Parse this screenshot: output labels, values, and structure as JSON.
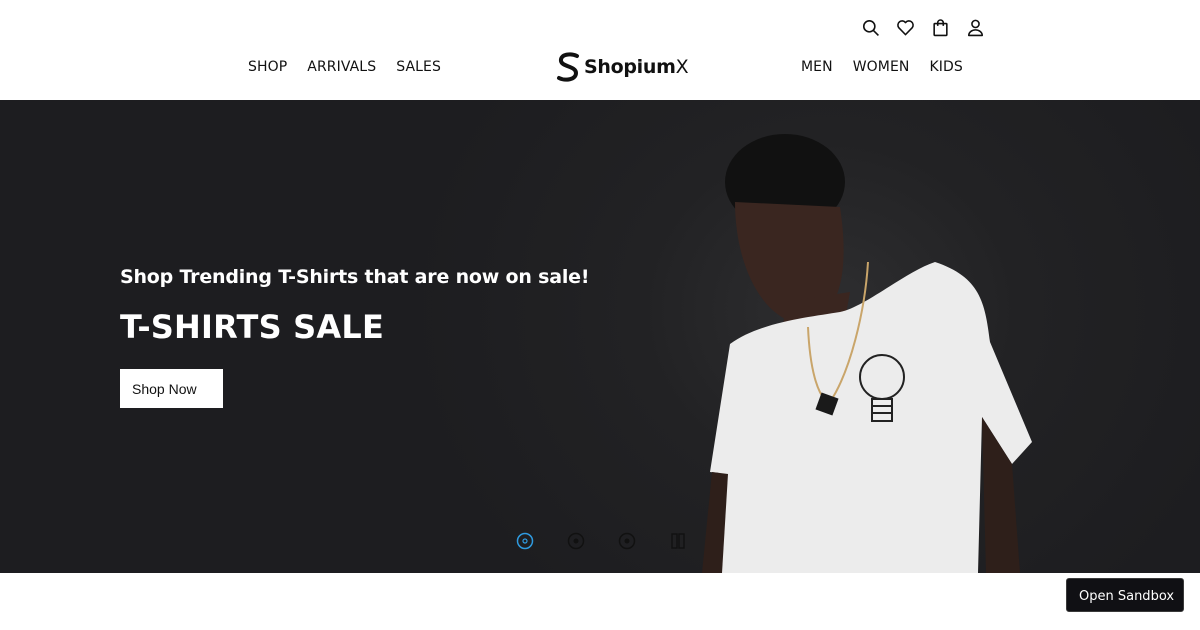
{
  "header": {
    "nav_left": [
      "SHOP",
      "ARRIVALS",
      "SALES"
    ],
    "nav_right": [
      "MEN",
      "WOMEN",
      "KIDS"
    ],
    "logo": {
      "bold": "Shopium",
      "light": "X"
    },
    "icons": [
      "search-icon",
      "heart-icon",
      "bag-icon",
      "user-icon"
    ]
  },
  "hero": {
    "subtitle": "Shop Trending T-Shirts that are now on sale!",
    "title": "T-SHIRTS SALE",
    "cta_label": "Shop Now",
    "carousel": {
      "slides": 3,
      "active_slide": 1,
      "controls": [
        "slide-dot-1",
        "slide-dot-2",
        "slide-dot-3",
        "pause-icon"
      ]
    }
  },
  "sandbox_button": {
    "label": "Open Sandbox"
  },
  "colors": {
    "hero_bg": "#1d1d20",
    "accent_dot": "#2f9be0",
    "sandbox_bg": "#101014"
  }
}
